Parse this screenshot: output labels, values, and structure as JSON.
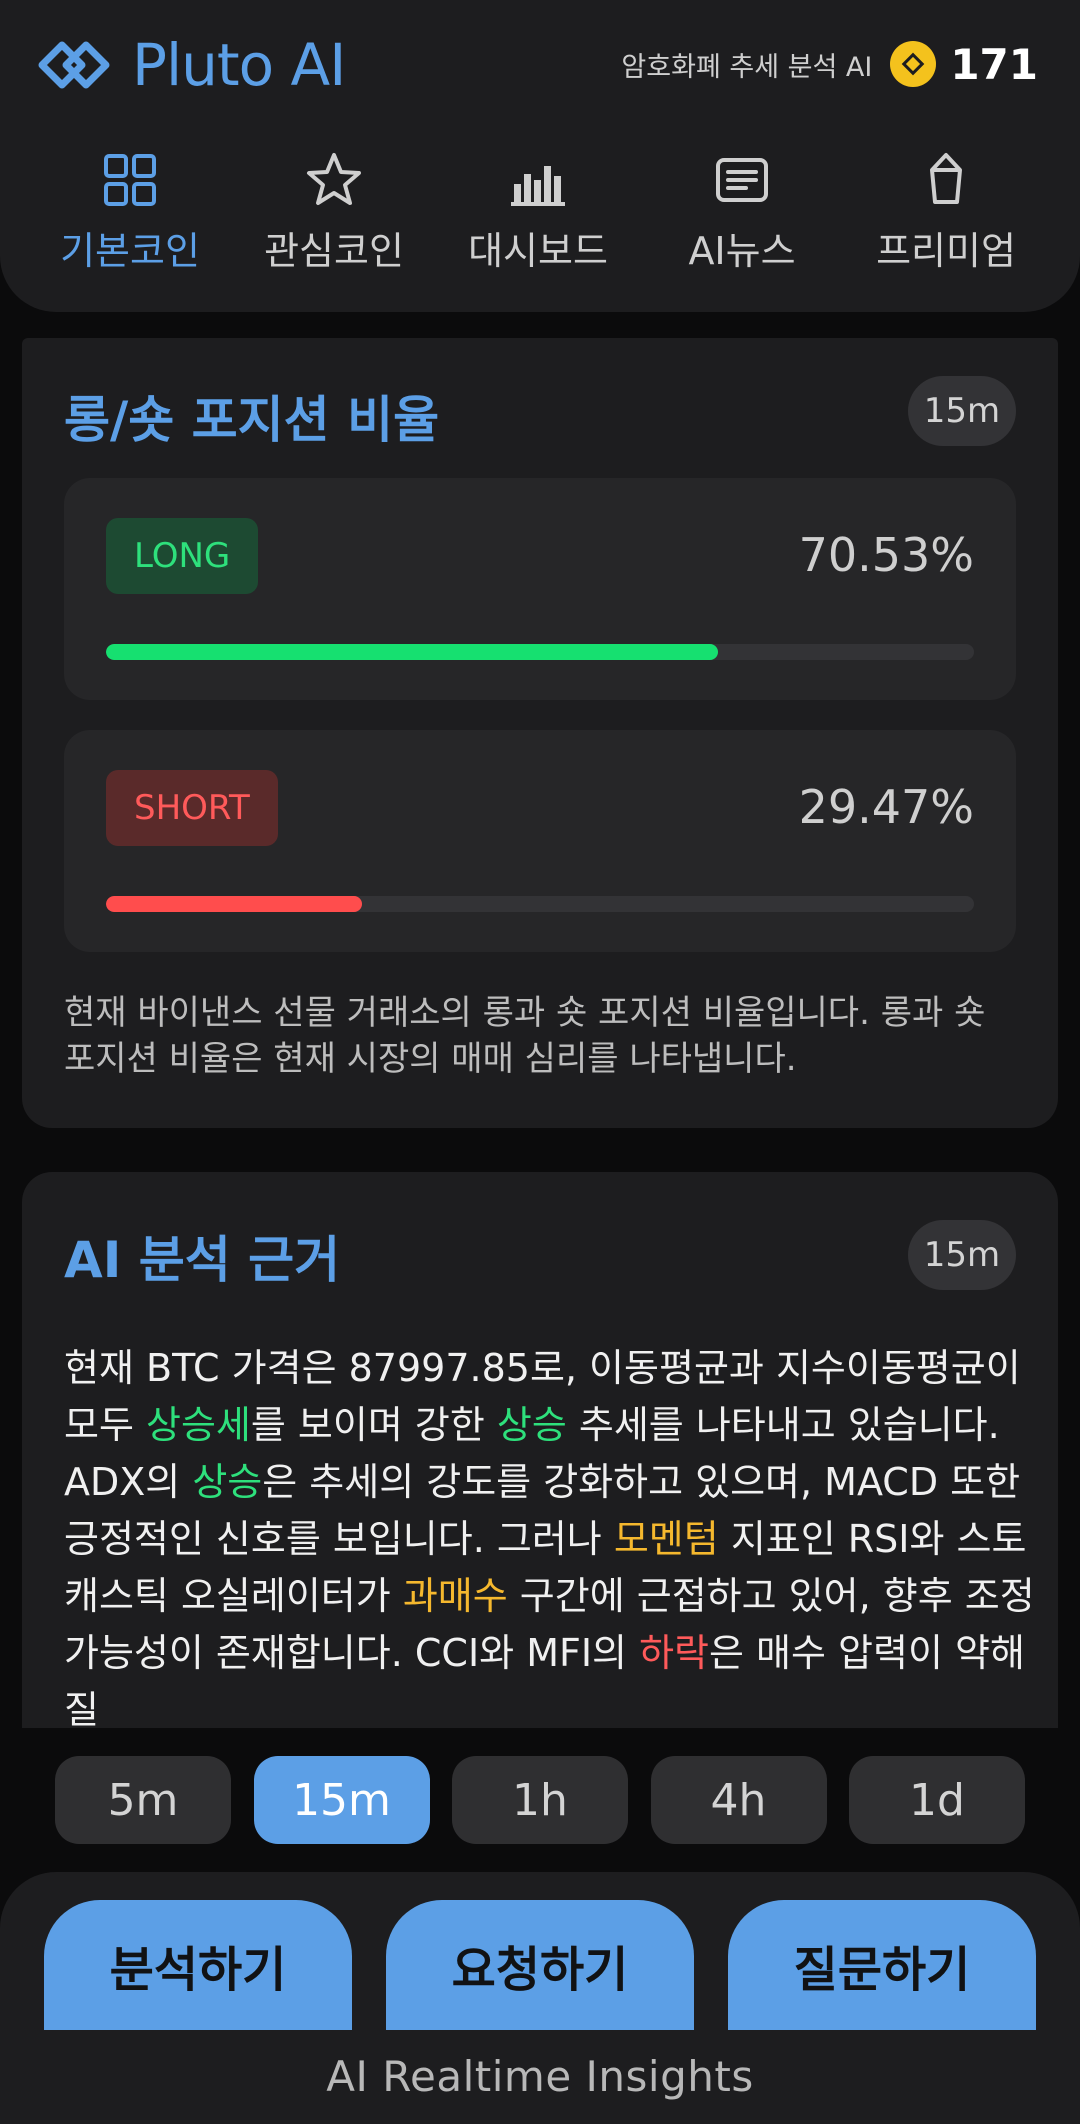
{
  "header": {
    "app_name": "Pluto AI",
    "subtitle": "암호화폐 추세 분석 AI",
    "coin_count": "171",
    "colors": {
      "accent": "#5c9fe6",
      "coin": "#f4c21d"
    }
  },
  "nav": {
    "items": [
      {
        "label": "기본코인",
        "icon": "grid-icon",
        "active": true
      },
      {
        "label": "관심코인",
        "icon": "star-icon",
        "active": false
      },
      {
        "label": "대시보드",
        "icon": "bar-chart-icon",
        "active": false
      },
      {
        "label": "AI뉴스",
        "icon": "news-icon",
        "active": false
      },
      {
        "label": "프리미엄",
        "icon": "gem-icon",
        "active": false
      }
    ]
  },
  "position_ratio": {
    "title": "롱/숏 포지션 비율",
    "timeframe": "15m",
    "long": {
      "label": "LONG",
      "percent_text": "70.53%",
      "value": 70.53,
      "color": "#16e070"
    },
    "short": {
      "label": "SHORT",
      "percent_text": "29.47%",
      "value": 29.47,
      "color": "#ff4d4d"
    },
    "description": "현재 바이낸스 선물 거래소의 롱과 숏 포지션 비율입니다. 롱과 숏 포지션 비율은 현재 시장의 매매 심리를 나타냅니다."
  },
  "analysis": {
    "title": "AI 분석 근거",
    "timeframe": "15m",
    "segments": [
      {
        "text": "현재 BTC 가격은 87997.85로, 이동평균과 지수이동평균이 모두 ",
        "hl": ""
      },
      {
        "text": "상승세",
        "hl": "green"
      },
      {
        "text": "를 보이며 강한 ",
        "hl": ""
      },
      {
        "text": "상승",
        "hl": "green"
      },
      {
        "text": " 추세를 나타내고 있습니다. ADX의 ",
        "hl": ""
      },
      {
        "text": "상승",
        "hl": "green"
      },
      {
        "text": "은 추세의 강도를 강화하고 있으며, MACD 또한 긍정적인 신호를 보입니다. 그러나 ",
        "hl": ""
      },
      {
        "text": "모멘텀",
        "hl": "yellow"
      },
      {
        "text": " 지표인 RSI와 스토캐스틱 오실레이터가 ",
        "hl": ""
      },
      {
        "text": "과매수",
        "hl": "yellow"
      },
      {
        "text": " 구간에 근접하고 있어, 향후 조정 가능성이 존재합니다. CCI와 MFI의 ",
        "hl": ""
      },
      {
        "text": "하락",
        "hl": "red"
      },
      {
        "text": "은 매수 압력이 약해질",
        "hl": ""
      }
    ]
  },
  "timeframes": {
    "options": [
      "5m",
      "15m",
      "1h",
      "4h",
      "1d"
    ],
    "selected": "15m"
  },
  "actions": {
    "analyze": "분석하기",
    "request": "요청하기",
    "ask": "질문하기"
  },
  "footer": "AI Realtime Insights"
}
